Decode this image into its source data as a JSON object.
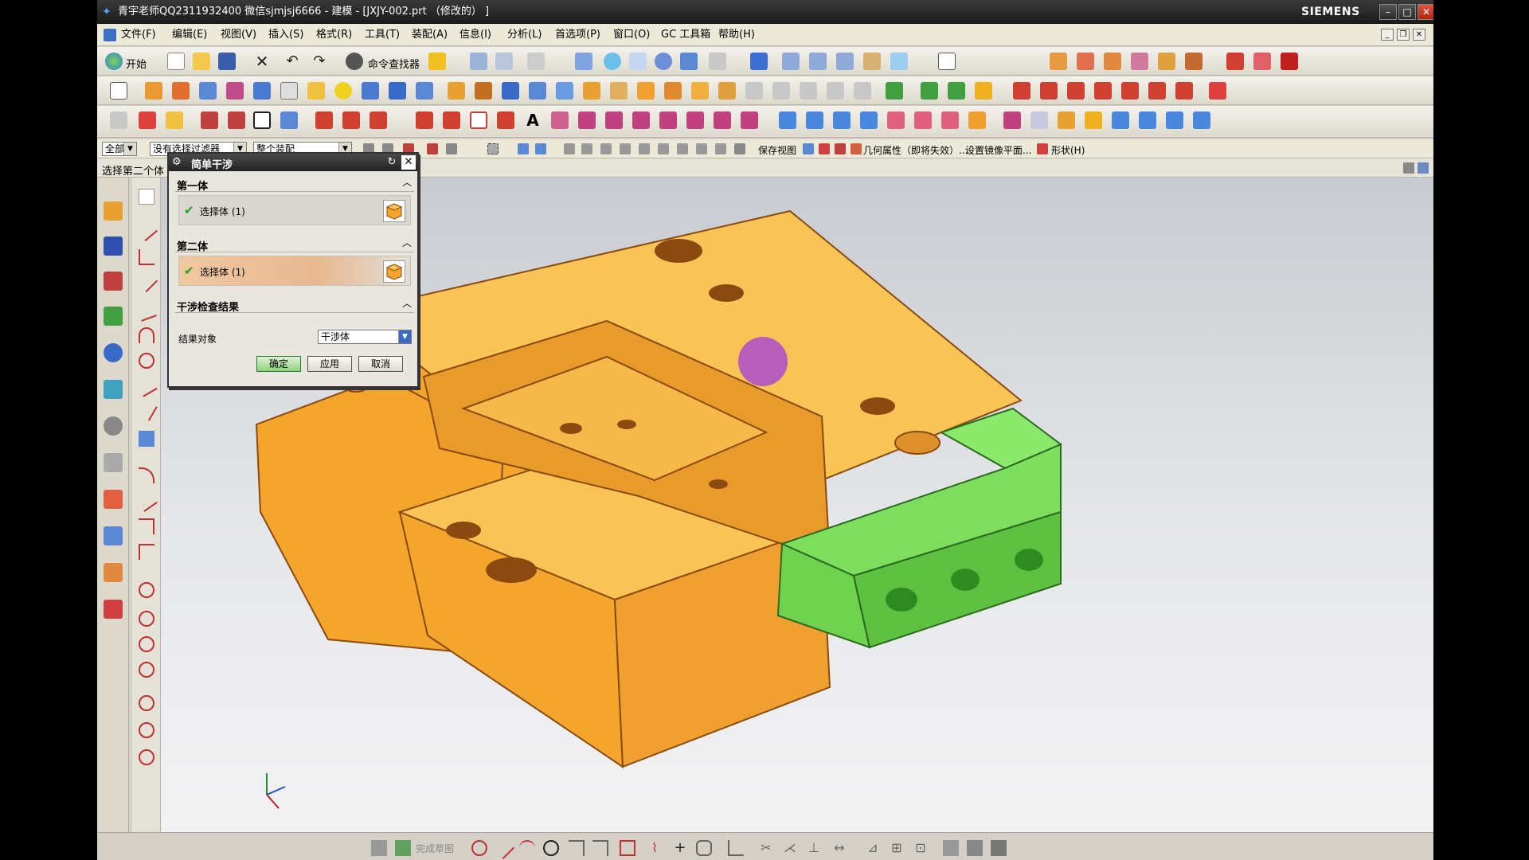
{
  "window": {
    "title": "青宇老师QQ2311932400 微信sjmjsj6666 - 建模 - [JXJY-002.prt （修改的） ]",
    "brand": "SIEMENS",
    "minimize": "–",
    "maximize": "□",
    "close": "✕"
  },
  "menu": [
    "文件(F)",
    "编辑(E)",
    "视图(V)",
    "插入(S)",
    "格式(R)",
    "工具(T)",
    "装配(A)",
    "信息(I)",
    "分析(L)",
    "首选项(P)",
    "窗口(O)",
    "GC 工具箱",
    "帮助(H)"
  ],
  "toolbar": {
    "start_label": "开始",
    "command_finder_label": "命令查找器"
  },
  "selection_bar": {
    "type_filter": "全部",
    "selection_filter": "没有选择过滤器",
    "scope": "整个装配",
    "save_view": "保存视图",
    "geometry_props": "几何属性（即将失效）...",
    "mirror_plane": "设置镜像平面...",
    "shape": "形状(H)"
  },
  "cue": "选择第二个体",
  "dialog": {
    "title": "简单干涉",
    "first_body_group": "第一体",
    "first_body_select": "选择体 (1)",
    "second_body_group": "第二体",
    "second_body_select": "选择体 (1)",
    "results_group": "干涉检查结果",
    "result_object_label": "结果对象",
    "result_object_value": "干涉体",
    "ok": "确定",
    "apply": "应用",
    "cancel": "取消"
  },
  "sketch_bar": {
    "finish_sketch": "完成草图"
  },
  "colors": {
    "part_orange": "#f3a52c",
    "part_top": "#f8c455",
    "part_green": "#6fd24e",
    "edge": "#8a4a10",
    "cursor": "#a03cdc"
  }
}
